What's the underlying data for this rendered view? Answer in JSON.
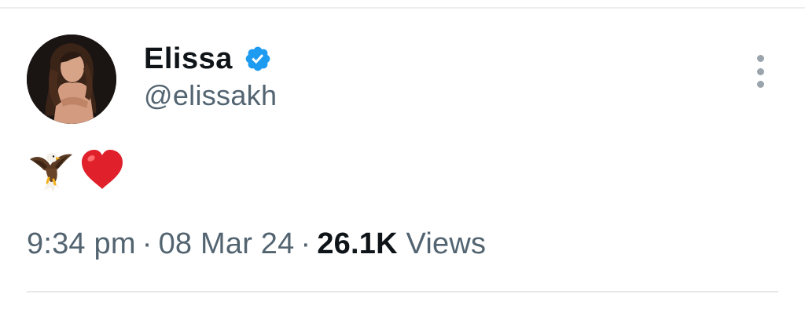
{
  "tweet": {
    "author": {
      "display_name": "Elissa",
      "handle": "@elissakh",
      "verified": true,
      "avatar_icon": "profile-photo"
    },
    "menu_icon": "more-vertical-icon",
    "body_emojis": [
      "eagle",
      "red-heart"
    ],
    "meta": {
      "time": "9:34 pm",
      "separator": "·",
      "date": "08 Mar 24",
      "views_count": "26.1K",
      "views_label": "Views"
    }
  },
  "colors": {
    "verified_badge": "#1d9bf0",
    "primary_text": "#0f1419",
    "secondary_text": "#536471",
    "heart": "#e0202a"
  }
}
